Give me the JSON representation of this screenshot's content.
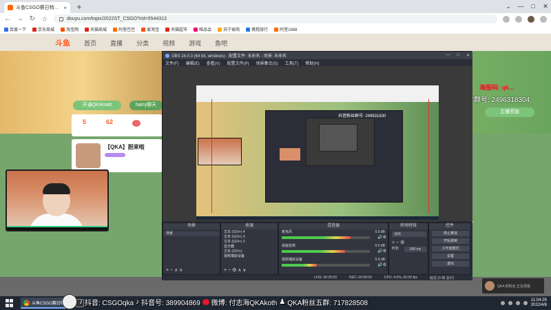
{
  "browser": {
    "tab_title": "斗鱼CSGO赛日特…",
    "tab_close": "×",
    "new_tab": "+",
    "window_controls": [
      "⌄",
      "—",
      "□",
      "✕"
    ],
    "url": "douyu.com/topic/2022ST_CSGO?rid=5544313",
    "nav": [
      "←",
      "→",
      "↻",
      "⌂"
    ],
    "bookmarks": [
      {
        "label": "百度一下",
        "color": "#2f6ff0"
      },
      {
        "label": "京东商城",
        "color": "#e1251b"
      },
      {
        "label": "淘宝网",
        "color": "#ff5000"
      },
      {
        "label": "天猫商城",
        "color": "#e1251b"
      },
      {
        "label": "阿里巴巴",
        "color": "#ff6a00"
      },
      {
        "label": "爱淘宝",
        "color": "#ff5000"
      },
      {
        "label": "天猫超市",
        "color": "#e1251b"
      },
      {
        "label": "唯品会",
        "color": "#f10180"
      },
      {
        "label": "苏宁易购",
        "color": "#ffaa00"
      },
      {
        "label": "携程旅行",
        "color": "#2577e3"
      },
      {
        "label": "阿里1688",
        "color": "#ff6a00"
      }
    ]
  },
  "douyu": {
    "logo": "斗鱼",
    "nav": [
      "首页",
      "直播",
      "分类",
      "视频",
      "游戏",
      "鱼吧"
    ],
    "buttons": [
      "开通QKAmatt",
      "harry聊天"
    ],
    "badge_numbers": [
      "5",
      "62"
    ],
    "streamer_name": "【QKA】胆来啦",
    "right_red": "海报码:  qk...",
    "douyin_group": "抖音粉丝群号: 2496318304",
    "zhuyuan": "主播奖励"
  },
  "obs": {
    "title": "OBS 24.0.3 (64 bit, windows) - 配置文件: 未命名 - 场景: 未命名",
    "window_controls": [
      "—",
      "□",
      "✕"
    ],
    "menu": [
      "文件(F)",
      "编辑(E)",
      "查看(V)",
      "配置文件(P)",
      "场景集合(S)",
      "工具(T)",
      "帮助(H)"
    ],
    "preview_caption": "抖音粉丝群号: 249631830",
    "docks": {
      "scenes": {
        "title": "场景",
        "items": [
          "场景"
        ]
      },
      "sources": {
        "title": "来源",
        "items": [
          "文本 (GDI+) 4",
          "文本 (GDI+) 3",
          "文本 (GDI+) 2",
          "显示器",
          "文本 (GDI+)",
          "视频捕获设备"
        ]
      },
      "mixer": {
        "title": "混音器",
        "channels": [
          {
            "name": "麦克风",
            "db": "0.0 dB",
            "level": 0.78
          },
          {
            "name": "桌面音频",
            "db": "0.0 dB",
            "level": 0.72
          },
          {
            "name": "视频捕获设备",
            "db": "0.0 dB",
            "level": 0.4
          }
        ]
      },
      "transitions": {
        "title": "转场特效",
        "type": "淡出",
        "duration_label": "时长",
        "duration": "300 ms"
      },
      "controls": {
        "title": "控件",
        "buttons": [
          "停止推流",
          "开始录制",
          "工作室模式",
          "设置",
          "退出"
        ]
      }
    },
    "status": [
      "LIVE: 00:00:00",
      "REC: 00:00:00",
      "CPU: 4.0%, 60.00 fps",
      "延迟 (0 帧 总计)"
    ]
  },
  "popup": {
    "text": "QKA 的粉丝 正在观看"
  },
  "taskbar": {
    "active_task": "斗鱼CSGO赛日特…",
    "clock_time": "11:04:29",
    "clock_date": "2022/4/8"
  },
  "caption": {
    "text1": "抖音: CSGOqka",
    "text2": "抖音号: 389904869",
    "text3": "微博: 付志海QKAkoth",
    "text4": "QKA粉丝五群: 717828508"
  }
}
